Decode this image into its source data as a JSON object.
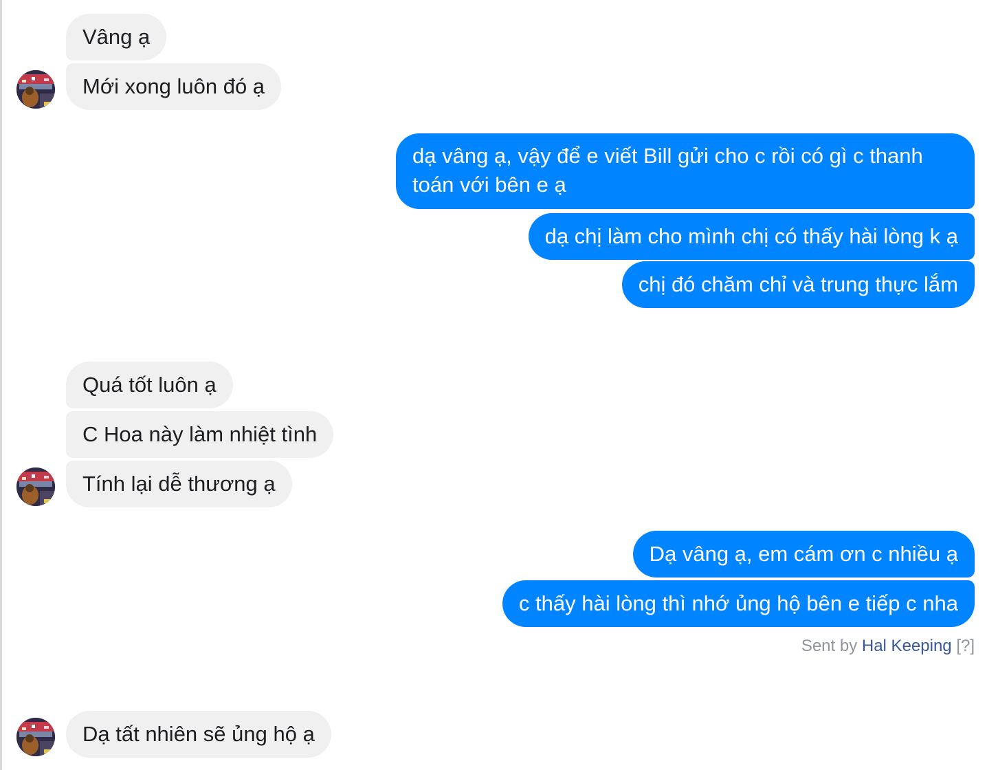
{
  "colors": {
    "incoming_bubble": "#f0f0f0",
    "outgoing_bubble": "#0084ff",
    "incoming_text": "#1c1e21",
    "outgoing_text": "#ffffff",
    "sender_link": "#385898",
    "meta_text": "#90949c"
  },
  "messages": [
    {
      "direction": "incoming",
      "text": "Vâng ạ"
    },
    {
      "direction": "incoming",
      "text": "Mới xong luôn đó ạ"
    },
    {
      "direction": "outgoing",
      "text": "dạ vâng ạ, vậy để e viết Bill gửi cho c rồi có gì c thanh toán với bên e ạ"
    },
    {
      "direction": "outgoing",
      "text": "dạ chị làm cho mình chị có thấy hài lòng k ạ"
    },
    {
      "direction": "outgoing",
      "text": "chị đó chăm chỉ và trung thực lắm"
    },
    {
      "direction": "incoming",
      "text": "Quá tốt luôn ạ"
    },
    {
      "direction": "incoming",
      "text": "C Hoa này làm nhiệt tình"
    },
    {
      "direction": "incoming",
      "text": "Tính lại dễ thương ạ"
    },
    {
      "direction": "outgoing",
      "text": "Dạ vâng ạ, em cám ơn c nhiều ạ"
    },
    {
      "direction": "outgoing",
      "text": "c thấy hài lòng thì nhớ ủng hộ bên e tiếp c nha"
    },
    {
      "direction": "incoming",
      "text": "Dạ tất nhiên sẽ ủng hộ ạ"
    }
  ],
  "sent_by": {
    "prefix": "Sent by",
    "author": "Hal Keeping",
    "help": "[?]"
  },
  "avatar_icon": "contact-avatar-photo"
}
